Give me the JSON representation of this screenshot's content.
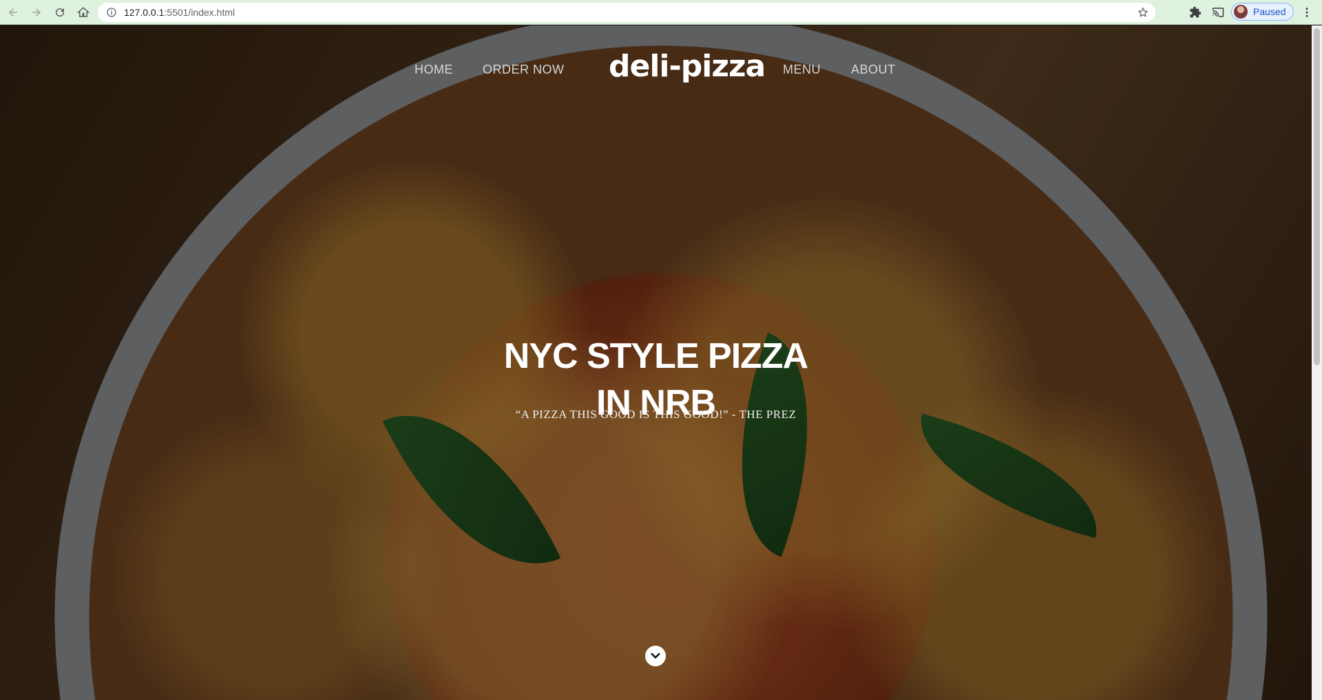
{
  "browser": {
    "url_host": "127.0.0.1",
    "url_rest": ":5501/index.html",
    "profile_status": "Paused",
    "icons": [
      "back-icon",
      "forward-icon",
      "reload-icon",
      "home-icon",
      "info-icon",
      "star-icon",
      "extensions-icon",
      "cast-icon",
      "kebab-menu-icon"
    ]
  },
  "site": {
    "logo": "deli-pizza",
    "nav": {
      "home": "HOME",
      "order": "ORDER NOW",
      "menu": "MENU",
      "about": "ABOUT"
    },
    "hero": {
      "title_line1": "NYC STYLE PIZZA",
      "title_line2": "IN NRB",
      "quote": "“A PIZZA THIS GOOD IS THIS GOOD!” - THE PREZ",
      "scroll_icon": "chevron-down-circle-icon"
    }
  },
  "colors": {
    "browser_bar": "#dff2df",
    "text_white": "#ffffff",
    "nav_text": "#d8d8d8"
  }
}
